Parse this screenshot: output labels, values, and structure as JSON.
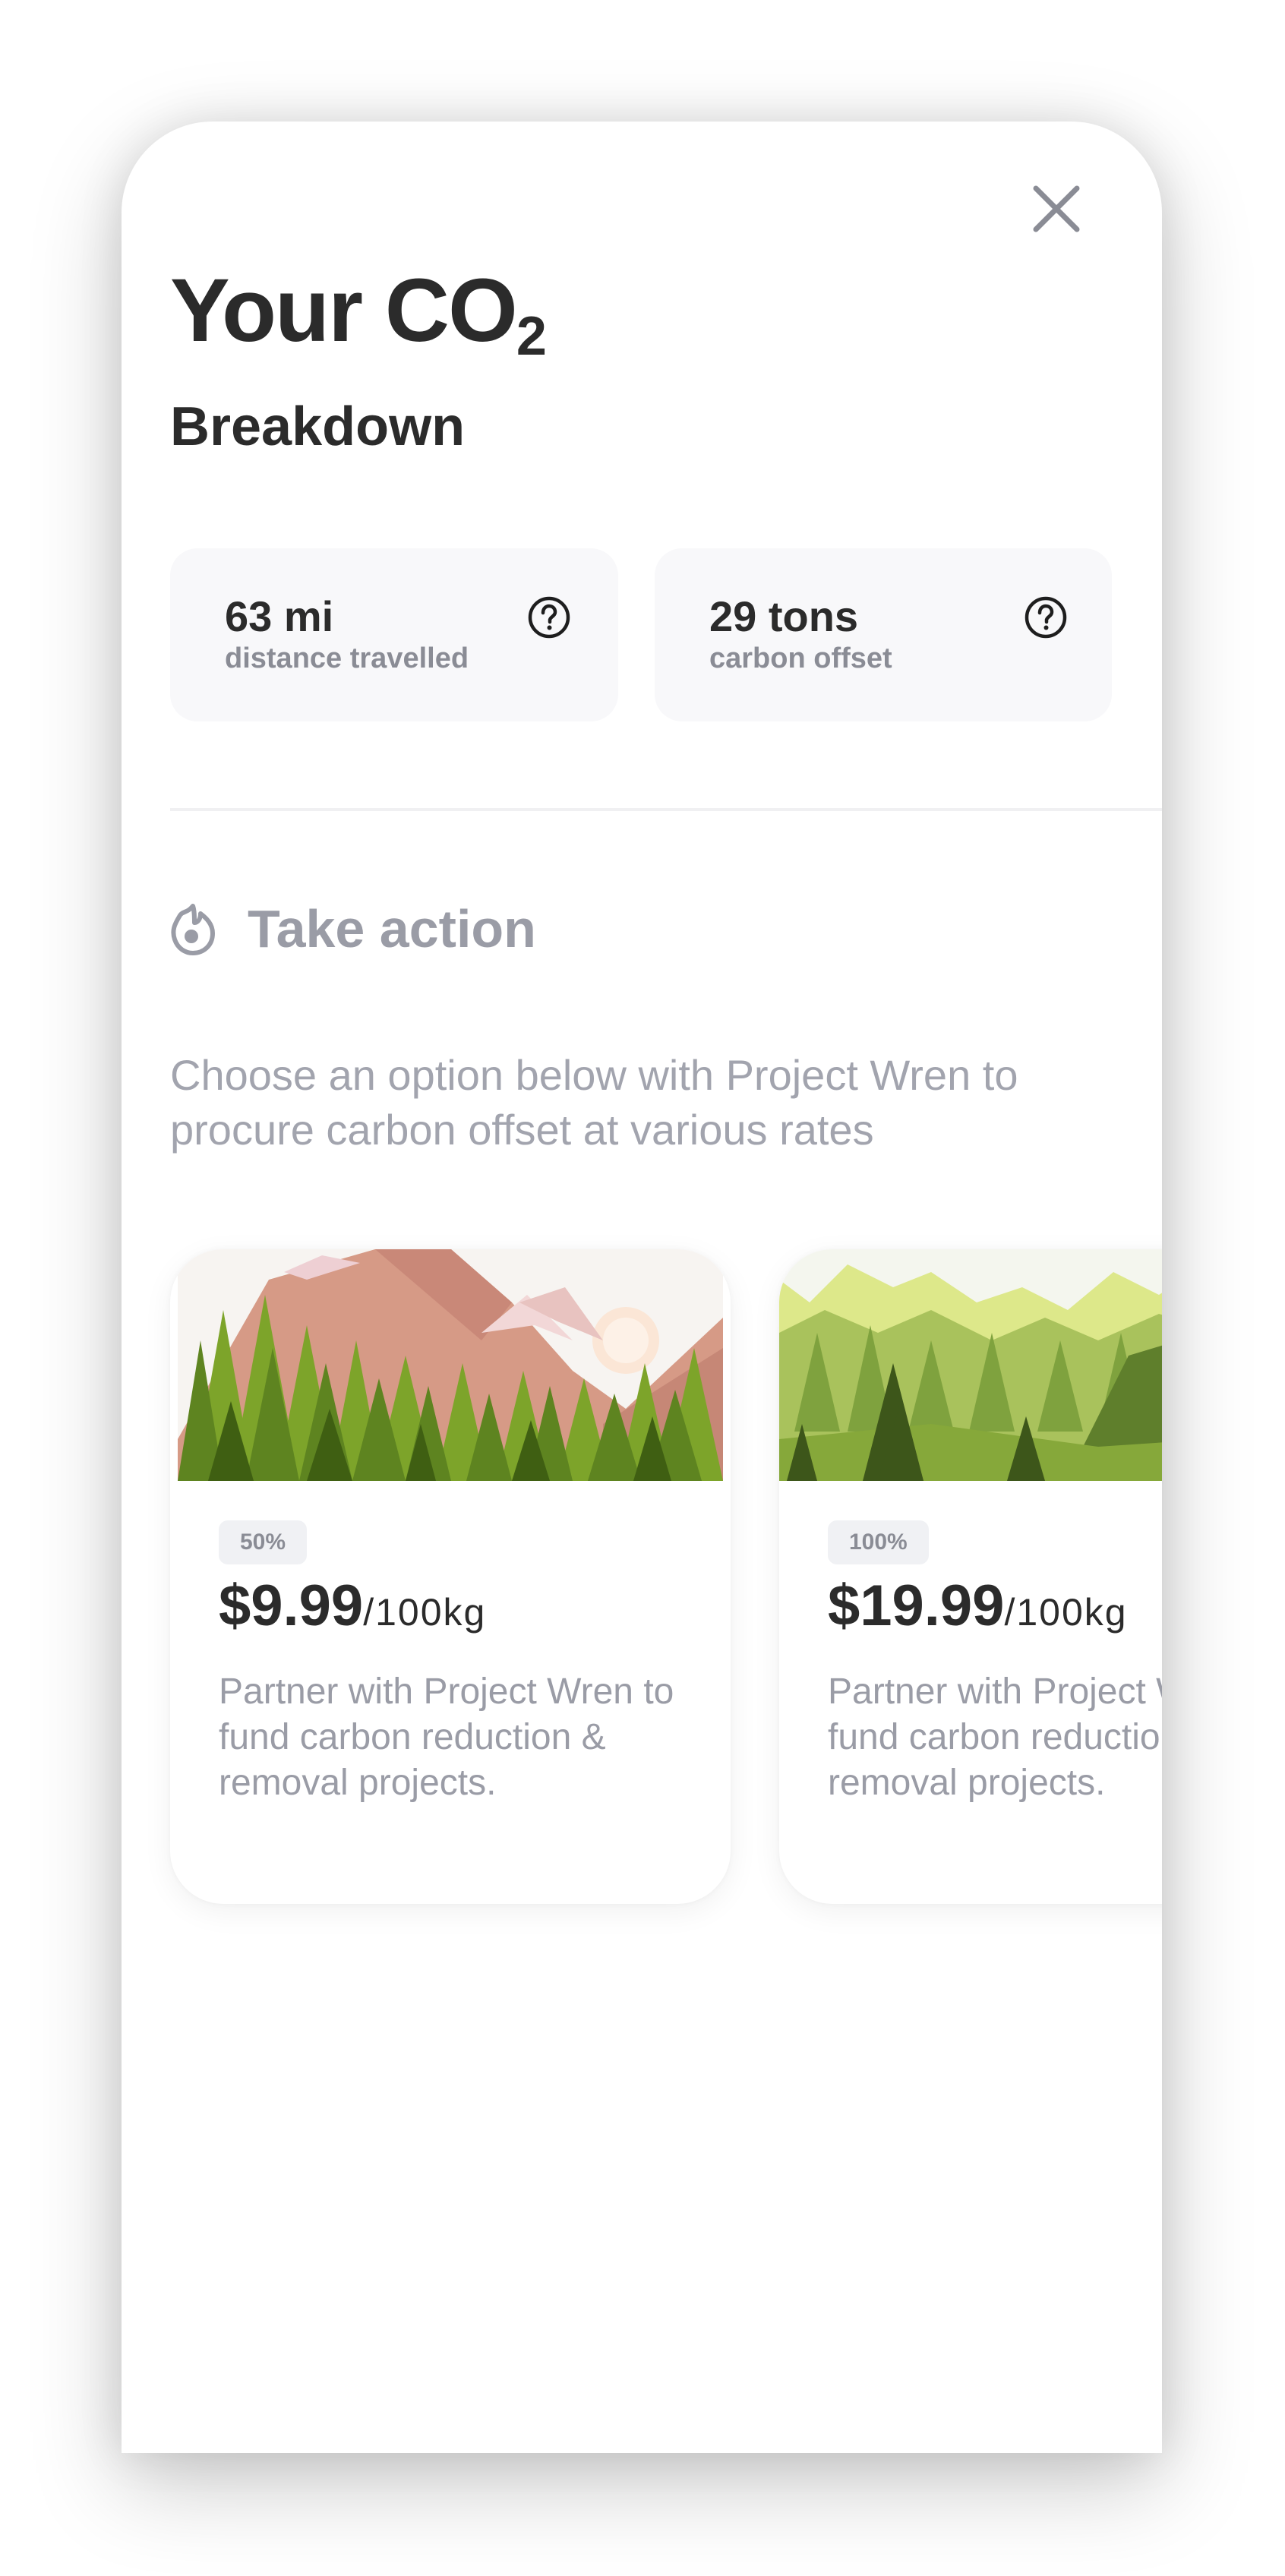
{
  "header": {
    "title": "Your CO",
    "title_subscript": "2",
    "subtitle": "Breakdown",
    "close_icon": "close-icon"
  },
  "stats": [
    {
      "value": "63 mi",
      "label": "distance travelled",
      "icon": "help-icon"
    },
    {
      "value": "29 tons",
      "label": "carbon offset",
      "icon": "help-icon"
    }
  ],
  "action": {
    "title": "Take action",
    "icon": "flame-icon",
    "description": "Choose an option below with Project Wren to procure carbon offset at various rates"
  },
  "options": [
    {
      "badge": "50%",
      "price": "$9.99",
      "unit": "/100kg",
      "description": "Partner with Project Wren to fund carbon reduction & removal projects."
    },
    {
      "badge": "100%",
      "price": "$19.99",
      "unit": "/100kg",
      "description": "Partner with Project Wren to fund carbon reduction & removal projects."
    }
  ],
  "colors": {
    "text_primary": "#2b2b2b",
    "text_muted": "#9a9ca6",
    "card_bg": "#f8f8fa",
    "badge_bg": "#f0f1f4"
  }
}
